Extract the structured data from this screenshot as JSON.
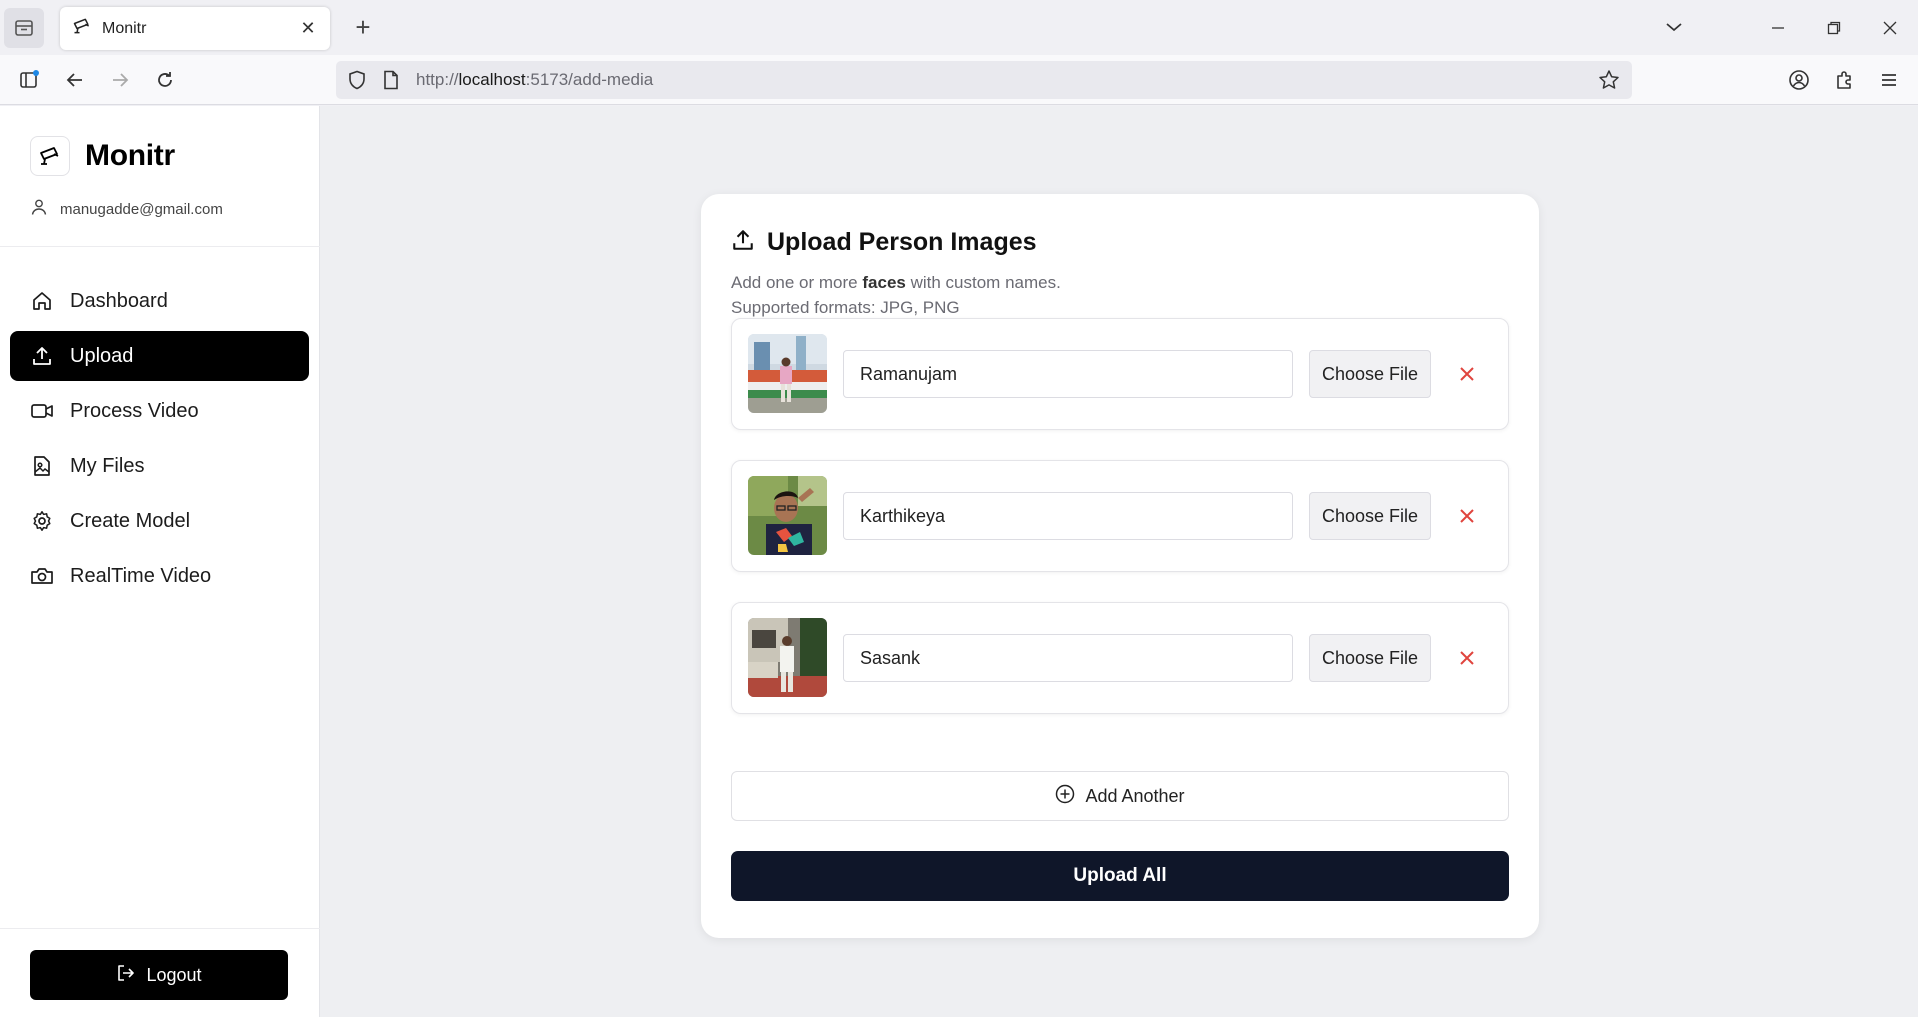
{
  "browser": {
    "tab_title": "Monitr",
    "url_scheme": "http://",
    "url_host": "localhost",
    "url_path": ":5173/add-media"
  },
  "sidebar": {
    "brand": "Monitr",
    "user_email": "manugadde@gmail.com",
    "items": [
      {
        "label": "Dashboard",
        "icon": "home-icon"
      },
      {
        "label": "Upload",
        "icon": "upload-icon",
        "active": true
      },
      {
        "label": "Process Video",
        "icon": "video-icon"
      },
      {
        "label": "My Files",
        "icon": "file-image-icon"
      },
      {
        "label": "Create Model",
        "icon": "gear-icon"
      },
      {
        "label": "RealTime Video",
        "icon": "camera-icon"
      }
    ],
    "logout_label": "Logout"
  },
  "main": {
    "title": "Upload Person Images",
    "subtitle_pre": "Add one or more",
    "subtitle_bold": "faces",
    "subtitle_post": "with custom names.",
    "formats": "Supported formats: JPG, PNG",
    "entries": [
      {
        "name": "Ramanujam",
        "choose_label": "Choose File"
      },
      {
        "name": "Karthikeya",
        "choose_label": "Choose File"
      },
      {
        "name": "Sasank",
        "choose_label": "Choose File"
      }
    ],
    "add_another_label": "Add Another",
    "upload_all_label": "Upload All"
  },
  "colors": {
    "primary_button": "#0f1629",
    "active_nav": "#000000",
    "remove_icon": "#e0443e"
  }
}
